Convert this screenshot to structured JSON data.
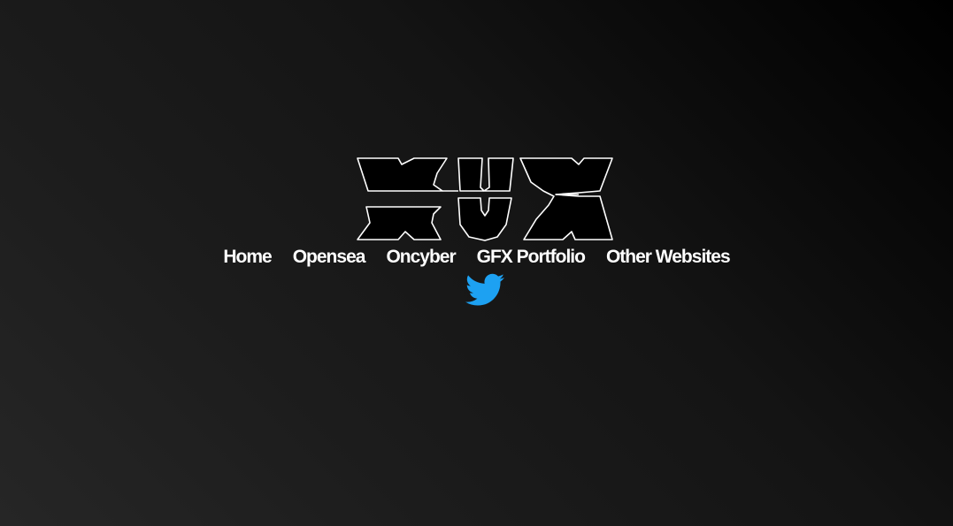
{
  "logo": {
    "text": "XUX",
    "fill_color": "#000000",
    "outline_color": "#ffffff"
  },
  "nav": {
    "items": [
      {
        "label": "Home"
      },
      {
        "label": "Opensea"
      },
      {
        "label": "Oncyber"
      },
      {
        "label": "GFX Portfolio"
      },
      {
        "label": "Other Websites"
      }
    ]
  },
  "social": {
    "icon": "twitter-icon",
    "color": "#1da1f2"
  },
  "colors": {
    "background_dark": "#000000",
    "background_light": "#262626",
    "nav_text": "#ffffff"
  }
}
